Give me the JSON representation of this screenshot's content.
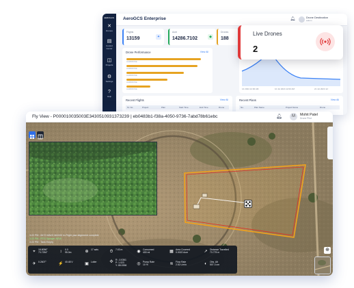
{
  "dashboard": {
    "sidebar": [
      {
        "icon": "✕",
        "label": "Drones"
      },
      {
        "icon": "▤",
        "label": "Control Center"
      },
      {
        "icon": "◫",
        "label": "Projects"
      },
      {
        "icon": "⚙",
        "label": "Settings"
      },
      {
        "icon": "?",
        "label": "Help"
      }
    ],
    "logo": "AEROGCS",
    "title": "AeroGCS Enterprise",
    "user_name": "Drone Destination",
    "user_sub": "Admin",
    "stats": [
      {
        "label": "Flights",
        "value": "13159",
        "color": "#3b82f6",
        "icon": "✦"
      },
      {
        "label": "Acre",
        "value": "14286.7102",
        "color": "#22a85a",
        "icon": "◆"
      },
      {
        "label": "Drones",
        "value": "188",
        "color": "#e6a321",
        "icon": "✈"
      }
    ],
    "drone_performance": {
      "title": "Drone Performance",
      "view_all": "View All",
      "bars": [
        0.94,
        0.9,
        0.72,
        0.52,
        0.3
      ],
      "bar_labels": [
        "AGRIDRONE",
        "AGRIDRONE",
        "AGRIDRONE",
        "AGRIDRONE",
        "AGRIDRONE"
      ]
    },
    "recent_flights": {
      "title": "Recent Flights",
      "view_all": "View All",
      "columns": [
        "Sr. No.",
        "Project",
        "Plan",
        "Start Time",
        "End Time",
        "Drone"
      ]
    },
    "recent_plans": {
      "title": "Recent Plans",
      "view_all": "View All",
      "columns": [
        "No.",
        "Plan Name",
        "Project Name",
        "Drone"
      ]
    },
    "flight_chart": {
      "x_labels": [
        "14 2024 12:00 AM",
        "10 Jul 2024 12:00 AM",
        "21 Jul 2024 12:"
      ]
    }
  },
  "live_drones": {
    "title": "Live Drones",
    "count": "2",
    "accent": "#e03a3a"
  },
  "fly_view": {
    "title": "Fly View - P000010035003E3430510931373239 | eb0483b1-f38a-4050-9736-7abd78b61ebc",
    "user_initial": "M",
    "user_name": "Mohit Patel",
    "user_sub": "Drone Pilot",
    "log": [
      {
        "text": "3:22 PM : 8472 MAVX MAX00 In-Flight yaw alignment complete",
        "green": false
      },
      {
        "text": "3:22 PM : RTG Sprayer NEW",
        "green": true
      },
      {
        "text": "3:22 PM : Tank Empty",
        "green": false
      }
    ],
    "telemetry": [
      {
        "icon": "⌖",
        "lines": [
          "18.8096°",
          "73.7254°"
        ]
      },
      {
        "icon": "↕",
        "lines": [
          "0.0",
          "95.0m"
        ]
      },
      {
        "icon": "⊕",
        "lines": [
          "17 sats",
          ""
        ]
      },
      {
        "icon": "⏱",
        "lines": [
          "7:03 m",
          ""
        ]
      },
      {
        "icon": "◉",
        "lines": [
          "Consumed",
          "400 ml"
        ]
      },
      {
        "icon": "▦",
        "lines": [
          "Area Covered",
          "0.0022 Acre"
        ]
      },
      {
        "icon": "↗",
        "lines": [
          "Distance Travelled",
          "73.775 m"
        ]
      },
      {
        "icon": "✈",
        "lines": [
          "0.2607°",
          ""
        ]
      },
      {
        "icon": "⚡",
        "lines": [
          "40.48 V",
          ""
        ]
      },
      {
        "icon": "▣",
        "lines": [
          "Loiter",
          ""
        ]
      },
      {
        "icon": "✣",
        "lines": [
          "R: -0.0361",
          "P: 1.023",
          "Y: 85.0356"
        ]
      },
      {
        "icon": "◎",
        "lines": [
          "Pump Rate",
          "10 %"
        ]
      },
      {
        "icon": "≋",
        "lines": [
          "Flow Rate",
          "2.52 L/min"
        ]
      },
      {
        "icon": "◐",
        "lines": [
          "Obs. Alt",
          "507.3 cm"
        ]
      }
    ],
    "compass_icon": "⊕"
  }
}
